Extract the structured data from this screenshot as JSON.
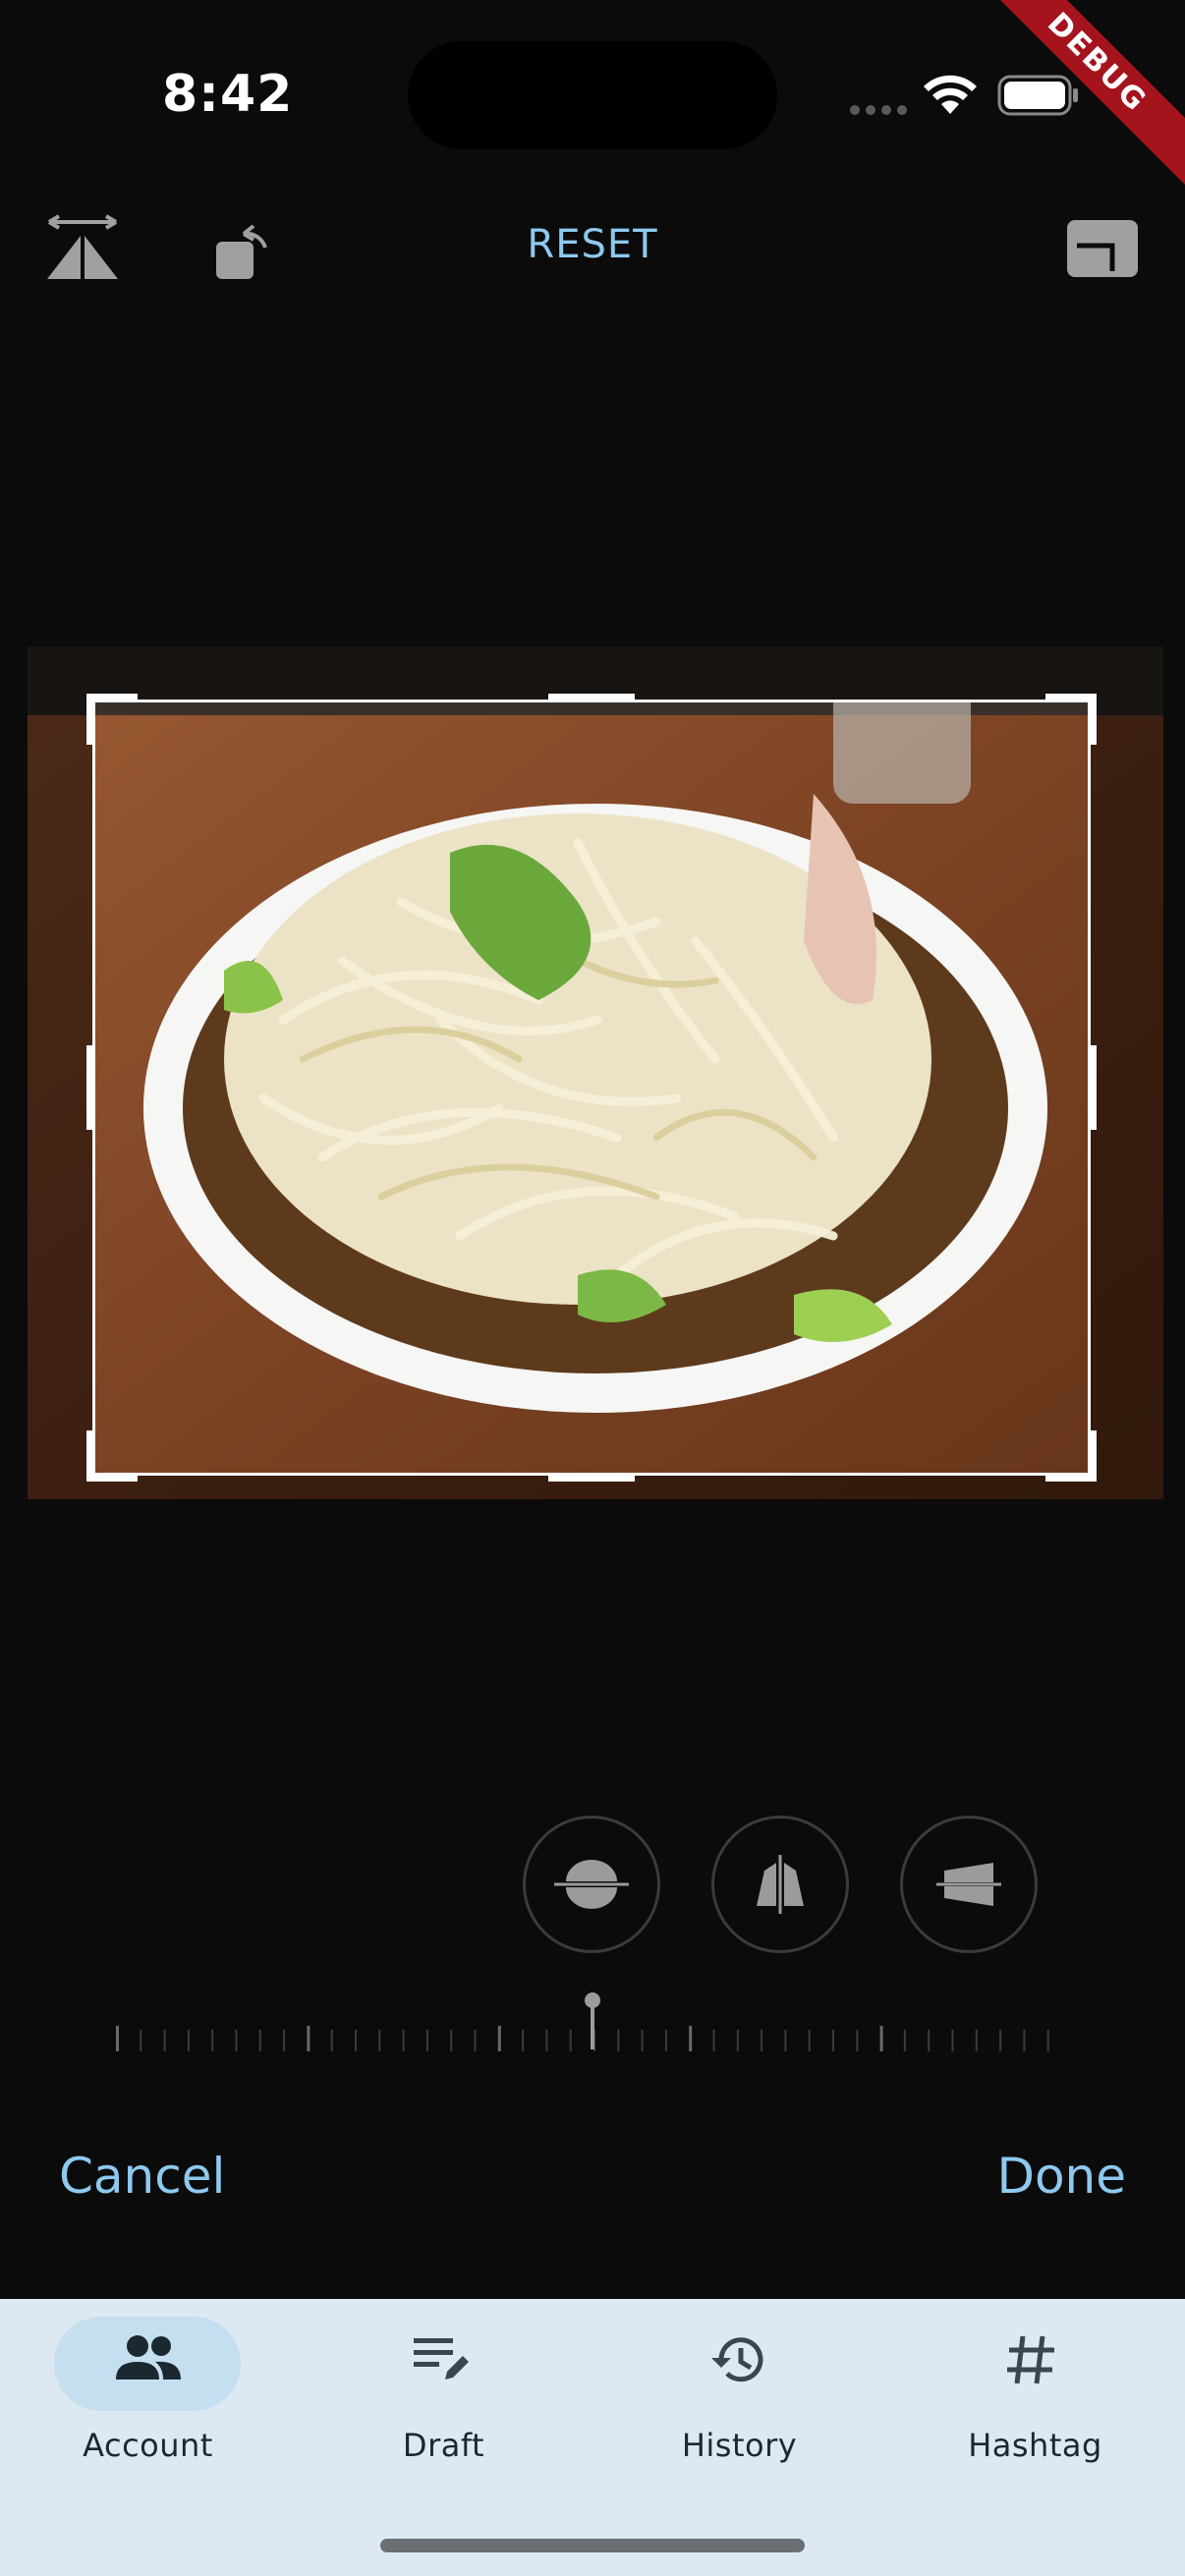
{
  "status_bar": {
    "time": "8:42",
    "debug_banner": "DEBUG"
  },
  "toolbar": {
    "flip_icon": "flip-horizontal-icon",
    "rotate_icon": "rotate-left-icon",
    "reset_label": "RESET",
    "aspect_icon": "aspect-ratio-icon"
  },
  "editor": {
    "image": "ramen-bowl-photo",
    "perspective_buttons": [
      {
        "name": "straighten-icon"
      },
      {
        "name": "vertical-perspective-icon"
      },
      {
        "name": "horizontal-perspective-icon"
      }
    ],
    "dial_value": 0
  },
  "actions": {
    "cancel_label": "Cancel",
    "done_label": "Done"
  },
  "bottom_nav": {
    "items": [
      {
        "label": "Account",
        "icon": "people-icon",
        "selected": true
      },
      {
        "label": "Draft",
        "icon": "edit-note-icon",
        "selected": false
      },
      {
        "label": "History",
        "icon": "history-icon",
        "selected": false
      },
      {
        "label": "Hashtag",
        "icon": "hashtag-icon",
        "selected": false
      }
    ]
  },
  "colors": {
    "background": "#0b0b0b",
    "accent": "#8ec9ef",
    "nav_background": "#dde9f2",
    "nav_selected": "#c4dff0",
    "debug": "#a5131d"
  }
}
